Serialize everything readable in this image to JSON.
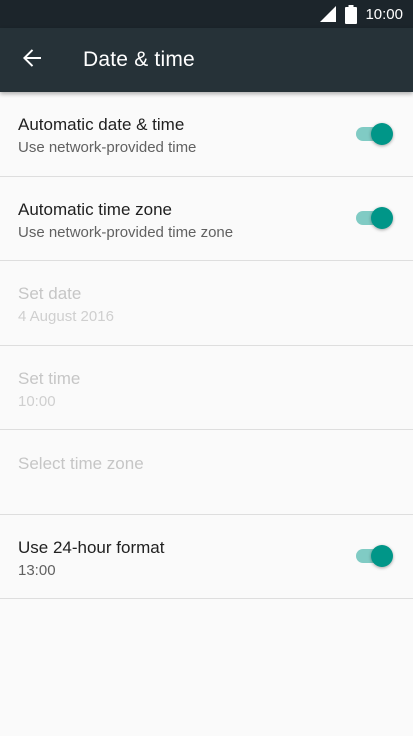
{
  "status_bar": {
    "time": "10:00",
    "signal_icon": "signal-icon",
    "battery_icon": "battery-icon"
  },
  "app_bar": {
    "title": "Date & time",
    "back_icon": "arrow-back-icon"
  },
  "accent_color": "#009688",
  "settings": [
    {
      "label": "Automatic date & time",
      "sub": "Use network-provided time",
      "toggle": true,
      "enabled": true
    },
    {
      "label": "Automatic time zone",
      "sub": "Use network-provided time zone",
      "toggle": true,
      "enabled": true
    },
    {
      "label": "Set date",
      "sub": "4 August 2016",
      "toggle": null,
      "enabled": false
    },
    {
      "label": "Set time",
      "sub": "10:00",
      "toggle": null,
      "enabled": false
    },
    {
      "label": "Select time zone",
      "sub": "",
      "toggle": null,
      "enabled": false
    },
    {
      "label": "Use 24-hour format",
      "sub": "13:00",
      "toggle": true,
      "enabled": true
    }
  ]
}
